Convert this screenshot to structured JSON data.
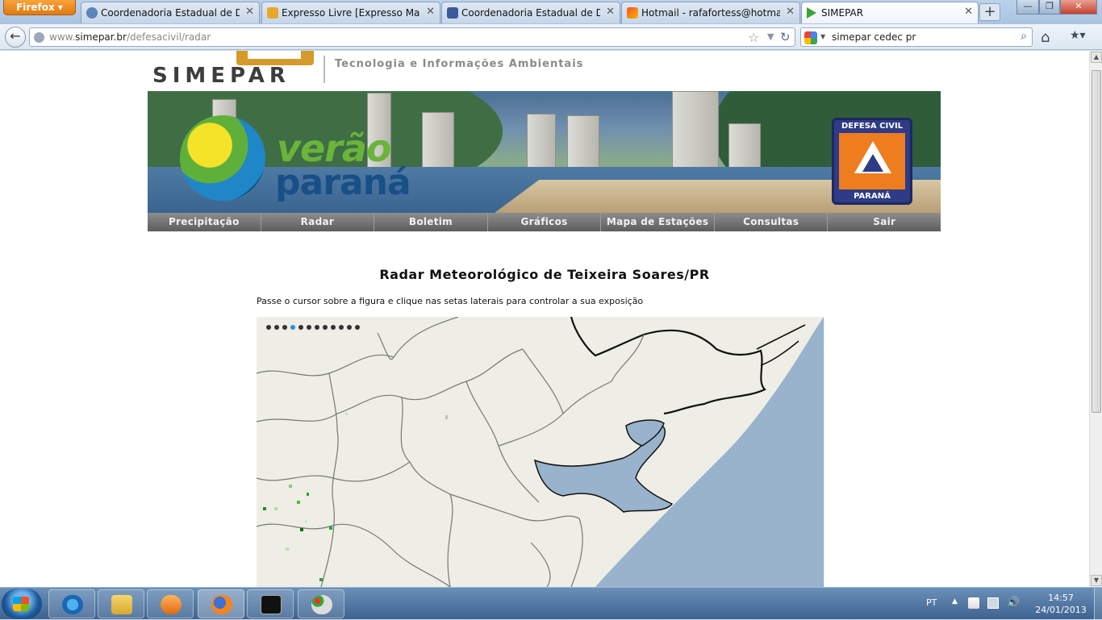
{
  "browser": {
    "menu_button": "Firefox",
    "tabs": [
      {
        "label": "Coordenadoria Estadual de Defe...",
        "icon": "globe-favicon"
      },
      {
        "label": "Expresso Livre [Expresso Mail]",
        "icon": "expresso-favicon"
      },
      {
        "label": "Coordenadoria Estadual de Defe...",
        "icon": "facebook-favicon"
      },
      {
        "label": "Hotmail - rafafortess@hotmail.c...",
        "icon": "hotmail-favicon"
      },
      {
        "label": "SIMEPAR",
        "icon": "simepar-play-favicon"
      }
    ],
    "url_prefix": "www.",
    "url_domain": "simepar.br",
    "url_path": "/defesacivil/radar",
    "search_query": "simepar cedec pr"
  },
  "site": {
    "logo_text": "SIMEPAR",
    "tagline": "Tecnologia e Informações Ambientais",
    "banner": {
      "title_line1": "verão",
      "title_line2": "paraná",
      "badge_top": "DEFESA CIVIL",
      "badge_bottom": "PARANÁ"
    },
    "menu": [
      "Precipitação",
      "Radar",
      "Boletim",
      "Gráficos",
      "Mapa de Estações",
      "Consultas",
      "Sair"
    ]
  },
  "main": {
    "title": "Radar Meteorológico de Teixeira Soares/PR",
    "instructions": "Passe o cursor sobre a figura e clique nas setas laterais para controlar a sua exposição",
    "frame_count": 12,
    "active_frame": 4
  },
  "taskbar": {
    "lang": "PT",
    "time": "14:57",
    "date": "24/01/2013",
    "apps": [
      "internet-explorer-icon",
      "windows-explorer-icon",
      "media-player-icon",
      "firefox-icon",
      "command-prompt-icon",
      "paint-icon"
    ]
  },
  "colors": {
    "sea": "#98b3cb",
    "land": "#eeeee6",
    "menu_bg": "#6f6f6f",
    "active_dot": "#2a8fdc"
  }
}
